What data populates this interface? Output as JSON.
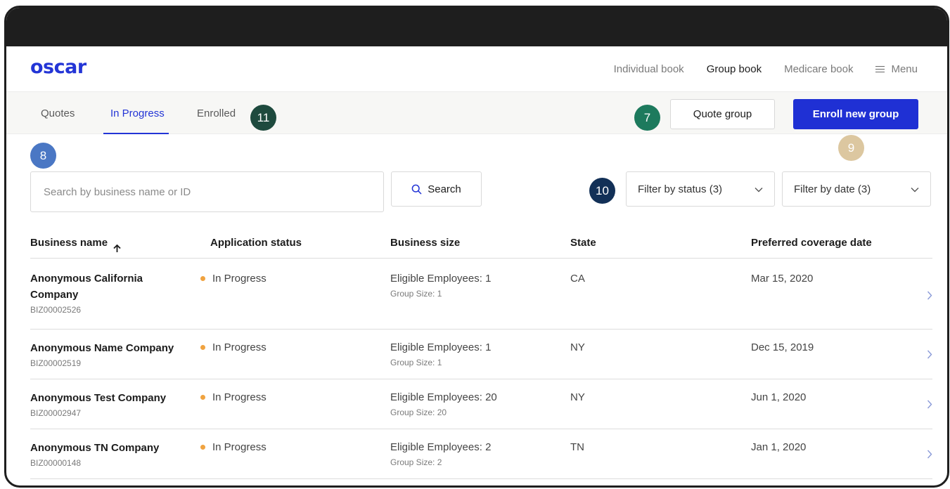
{
  "header": {
    "logo": "oscar",
    "nav": [
      "Individual book",
      "Group book",
      "Medicare book"
    ],
    "nav_active_index": 1,
    "menu_label": "Menu"
  },
  "subnav": {
    "tabs": [
      "Quotes",
      "In Progress",
      "Enrolled"
    ],
    "active_tab": "In Progress",
    "quote_button": "Quote group",
    "enroll_button": "Enroll new group"
  },
  "badges": {
    "b7": {
      "label": "7",
      "color": "#1d7a5d"
    },
    "b8": {
      "label": "8",
      "color": "#4a77c4"
    },
    "b9": {
      "label": "9",
      "color": "#dcc7a0"
    },
    "b10": {
      "label": "10",
      "color": "#123057"
    },
    "b11": {
      "label": "11",
      "color": "#1e4a3e"
    }
  },
  "search": {
    "placeholder": "Search by business name or ID",
    "button_label": "Search"
  },
  "filters": {
    "status": "Filter by status (3)",
    "date": "Filter by date (3)"
  },
  "table": {
    "columns": [
      "Business name",
      "Application status",
      "Business size",
      "State",
      "Preferred coverage date"
    ],
    "rows": [
      {
        "name_line1": "Anonymous California",
        "name_line2": "Company",
        "id": "BIZ00002526",
        "status": "In Progress",
        "eligible": "Eligible Employees: 1",
        "group": "Group Size: 1",
        "state": "CA",
        "date": "Mar 15, 2020"
      },
      {
        "name_line1": "Anonymous Name Company",
        "name_line2": "",
        "id": "BIZ00002519",
        "status": "In Progress",
        "eligible": "Eligible Employees: 1",
        "group": "Group Size: 1",
        "state": "NY",
        "date": "Dec 15, 2019"
      },
      {
        "name_line1": "Anonymous Test Company",
        "name_line2": "",
        "id": "BIZ00002947",
        "status": "In Progress",
        "eligible": "Eligible Employees: 20",
        "group": "Group Size: 20",
        "state": "NY",
        "date": "Jun 1, 2020"
      },
      {
        "name_line1": "Anonymous TN Company",
        "name_line2": "",
        "id": "BIZ00000148",
        "status": "In Progress",
        "eligible": "Eligible Employees: 2",
        "group": "Group Size: 2",
        "state": "TN",
        "date": "Jan 1, 2020"
      }
    ]
  },
  "colors": {
    "brand": "#2335d6",
    "status_dot": "#f0a340"
  },
  "icons": {
    "search": "search-icon",
    "menu": "hamburger-menu-icon",
    "dropdown": "chevron-down-icon",
    "row": "chevron-right-icon",
    "sort": "arrow-up-icon"
  }
}
